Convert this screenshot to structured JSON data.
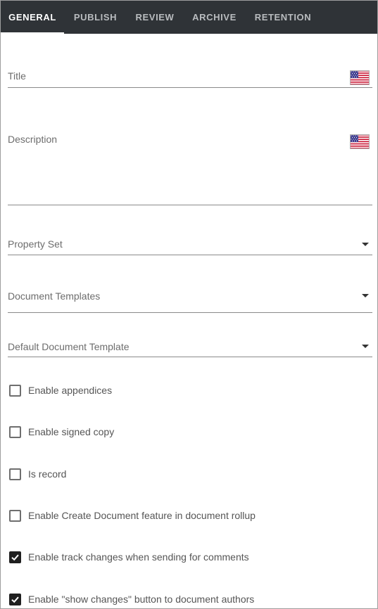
{
  "tabs": [
    {
      "label": "GENERAL",
      "active": true
    },
    {
      "label": "PUBLISH",
      "active": false
    },
    {
      "label": "REVIEW",
      "active": false
    },
    {
      "label": "ARCHIVE",
      "active": false
    },
    {
      "label": "RETENTION",
      "active": false
    }
  ],
  "form": {
    "title_label": "Title",
    "description_label": "Description",
    "property_set_label": "Property Set",
    "document_templates_label": "Document Templates",
    "default_document_template_label": "Default Document Template",
    "language_icon": "us-flag-icon"
  },
  "checkboxes": [
    {
      "label": "Enable appendices",
      "checked": false
    },
    {
      "label": "Enable signed copy",
      "checked": false
    },
    {
      "label": "Is record",
      "checked": false
    },
    {
      "label": "Enable Create Document feature in document rollup",
      "checked": false
    },
    {
      "label": "Enable track changes when sending for comments",
      "checked": true
    },
    {
      "label": "Enable \"show changes\" button to document authors",
      "checked": true
    }
  ],
  "colors": {
    "tabbar_bg": "#2f3337",
    "tab_active": "#ffffff",
    "tab_inactive": "#b9bcbf",
    "label": "#6d6d6d",
    "checkbox_checked": "#1f1f1f"
  }
}
